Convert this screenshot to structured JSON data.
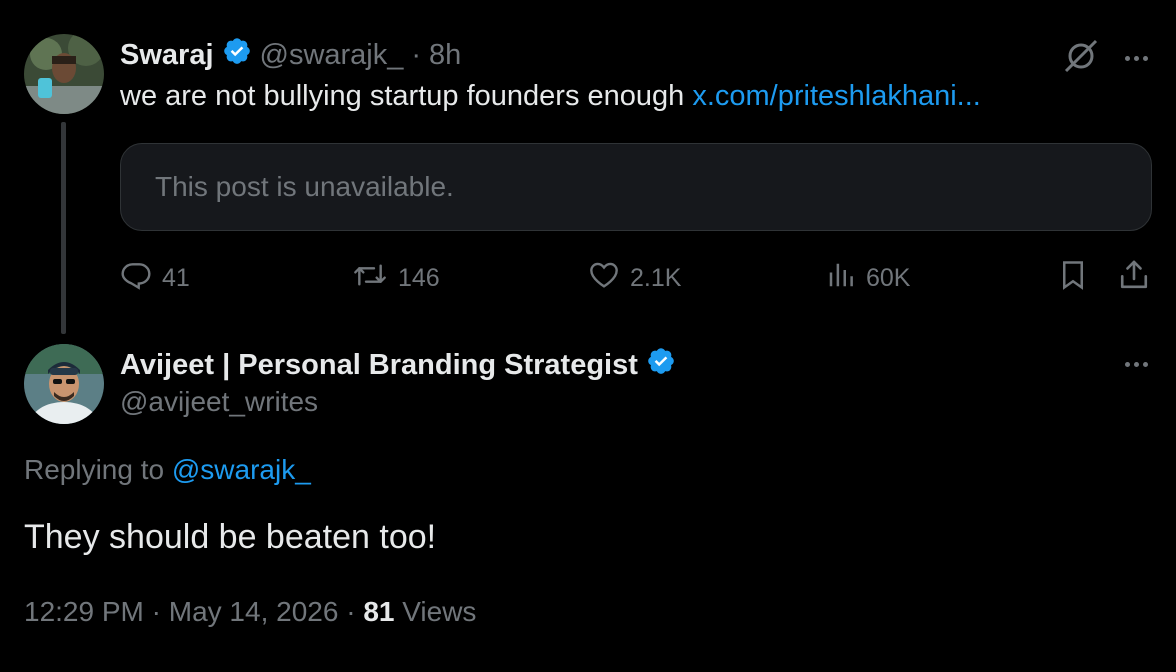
{
  "colors": {
    "background": "#000000",
    "text": "#e7e9ea",
    "muted": "#71767b",
    "link": "#1d9bf0",
    "verified": "#1d9bf0",
    "card": "#16181c",
    "border": "#2f3336"
  },
  "parent_post": {
    "author_name": "Swaraj",
    "handle": "@swarajk_",
    "separator": "·",
    "time": "8h",
    "text": "we are not bullying startup founders enough",
    "link_text": "x.com/priteshlakhani...",
    "quoted_post_text": "This post is unavailable.",
    "icons": [
      "grok-icon",
      "more-icon",
      "verified-badge-icon"
    ],
    "actions": {
      "replies": "41",
      "reposts": "146",
      "likes": "2.1K",
      "views": "60K"
    }
  },
  "reply_post": {
    "author_name": "Avijeet | Personal Branding Strategist",
    "handle": "@avijeet_writes",
    "replying_prefix": "Replying to",
    "replying_handle": "@swarajk_",
    "text": "They should be beaten too!",
    "time": "12:29 PM",
    "sep1": "·",
    "date": "May 14, 2026",
    "sep2": "·",
    "views_count": "81",
    "views_label": "Views"
  }
}
